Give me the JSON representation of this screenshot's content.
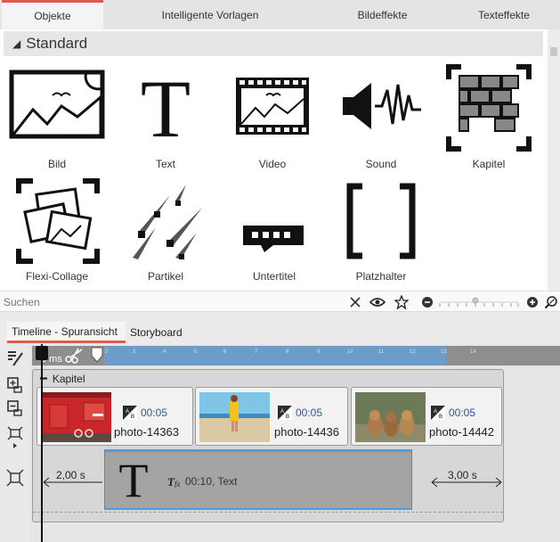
{
  "top_tabs": [
    {
      "label": "Objekte",
      "active": true
    },
    {
      "label": "Intelligente Vorlagen"
    },
    {
      "label": "Bildeffekte"
    },
    {
      "label": "Texteffekte"
    }
  ],
  "section": {
    "title": "Standard"
  },
  "objects": [
    {
      "label": "Bild",
      "icon": "image-icon"
    },
    {
      "label": "Text",
      "icon": "text-icon"
    },
    {
      "label": "Video",
      "icon": "video-icon"
    },
    {
      "label": "Sound",
      "icon": "sound-icon"
    },
    {
      "label": "Kapitel",
      "icon": "chapter-icon"
    },
    {
      "label": "Flexi-Collage",
      "icon": "flexi-collage-icon"
    },
    {
      "label": "Partikel",
      "icon": "particles-icon"
    },
    {
      "label": "Untertitel",
      "icon": "subtitle-icon"
    },
    {
      "label": "Platzhalter",
      "icon": "placeholder-icon"
    }
  ],
  "search": {
    "placeholder": "Suchen"
  },
  "timeline_tabs": [
    {
      "label": "Timeline - Spuransicht",
      "active": true
    },
    {
      "label": "Storyboard"
    }
  ],
  "ruler": {
    "unit_label": "0 ms",
    "ticks": [
      "1",
      "2",
      "3",
      "4",
      "5",
      "6",
      "7",
      "8",
      "9",
      "10",
      "11",
      "12",
      "13",
      "14"
    ]
  },
  "chapter": {
    "label": "Kapitel"
  },
  "clips": [
    {
      "duration": "00:05",
      "filename": "photo-14363"
    },
    {
      "duration": "00:05",
      "filename": "photo-14436"
    },
    {
      "duration": "00:05",
      "filename": "photo-14442"
    }
  ],
  "text_clip": {
    "duration_text": "00:10, Text",
    "trans_in": "2,00 s",
    "trans_out": "3,00 s"
  },
  "colors": {
    "accent": "#e05a4e",
    "selection": "#6c9dc9",
    "text_clip_border": "#4b9fe0"
  }
}
